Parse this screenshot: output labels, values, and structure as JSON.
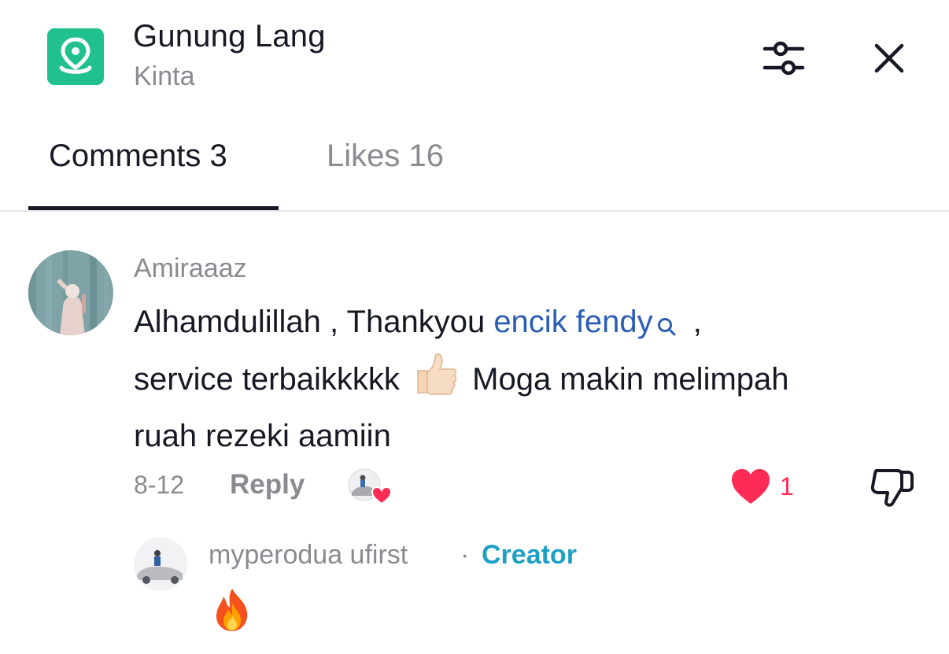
{
  "header": {
    "title": "Gunung Lang",
    "subtitle": "Kinta",
    "icon": "location-pin-icon",
    "icon_color": "#20c18f"
  },
  "tabs": [
    {
      "label": "Comments 3",
      "active": true
    },
    {
      "label": "Likes 16",
      "active": false
    }
  ],
  "comments": [
    {
      "username": "Amiraaaz",
      "text_before": "Alhamdulillah , Thankyou ",
      "mention": "encik fendy",
      "text_after_mention": " ,",
      "line2_before_emoji": "service terbaikkkkk",
      "line2_after_emoji": "Moga makin melimpah",
      "line3": "ruah rezeki aamiin",
      "date": "8-12",
      "reply_label": "Reply",
      "like_count": "1",
      "liked": true
    }
  ],
  "reply": {
    "username": "myperodua ufirst",
    "separator": "·",
    "badge": "Creator",
    "text": "🔥"
  },
  "colors": {
    "accent_red": "#fe2c55",
    "mention_blue": "#2b5db4",
    "creator_blue": "#1e9fc4"
  }
}
